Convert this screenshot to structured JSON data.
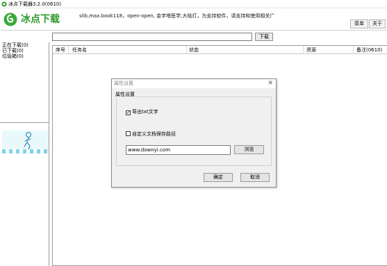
{
  "window": {
    "title": "冰点下载器3.2.0(0610)",
    "icon": "app-icon"
  },
  "header": {
    "logo_text": "冰点下载",
    "tagline": "slib,max.book118，open-open, 金字塔医学,大桔灯，为支持软件，请支持和使用相关广",
    "menu_label": "菜单",
    "about_label": "关于"
  },
  "search": {
    "value": "",
    "placeholder": "",
    "download_label": "下载"
  },
  "sidebar": {
    "items": [
      {
        "label": "正在下载(0)"
      },
      {
        "label": "已下载(0)"
      },
      {
        "label": "垃圾箱(0)"
      }
    ]
  },
  "table": {
    "columns": [
      {
        "label": "序号"
      },
      {
        "label": "任务名"
      },
      {
        "label": "状态"
      },
      {
        "label": "资源"
      },
      {
        "label": "备注(0610)"
      }
    ]
  },
  "dialog": {
    "title": "属性设置",
    "group_label": "属性设置",
    "export_txt_label": "导出txt文字",
    "export_txt_checked": true,
    "custom_path_label": "自定义文档保存路径",
    "custom_path_checked": false,
    "path_value": "www.downyi.com",
    "browse_label": "浏览",
    "ok_label": "确定",
    "cancel_label": "取消"
  },
  "colors": {
    "brand_green": "#2e9a2b",
    "dialog_bg": "#f0f0f0"
  }
}
